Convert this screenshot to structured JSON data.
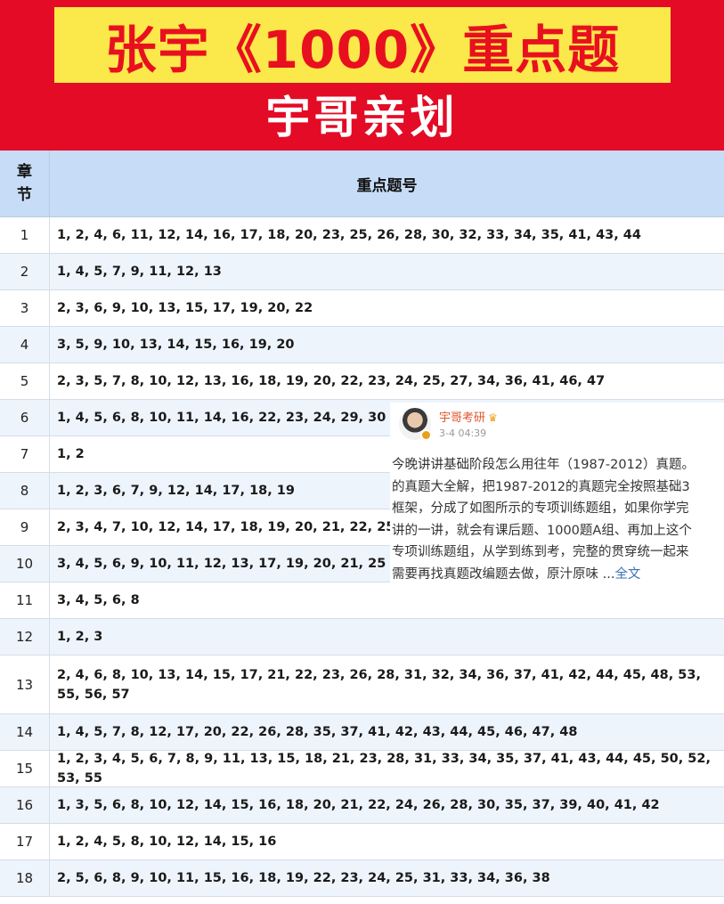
{
  "banner": {
    "title": "张宇《1000》重点题",
    "subtitle": "宇哥亲划"
  },
  "table": {
    "header_chapter_line1": "章",
    "header_chapter_line2": "节",
    "header_nums": "重点题号",
    "rows": [
      {
        "chapter": "1",
        "nums": "1, 2, 4, 6, 11, 12, 14, 16, 17, 18, 20, 23, 25, 26, 28, 30, 32, 33, 34, 35, 41, 43, 44"
      },
      {
        "chapter": "2",
        "nums": "1, 4, 5, 7, 9, 11, 12, 13"
      },
      {
        "chapter": "3",
        "nums": "2, 3, 6, 9, 10, 13, 15, 17, 19, 20, 22"
      },
      {
        "chapter": "4",
        "nums": "3, 5, 9, 10, 13, 14, 15, 16, 19, 20"
      },
      {
        "chapter": "5",
        "nums": "2, 3, 5, 7, 8, 10, 12, 13, 16, 18, 19, 20, 22, 23, 24, 25, 27, 34, 36, 41, 46, 47"
      },
      {
        "chapter": "6",
        "nums": "1, 4, 5, 6, 8, 10, 11, 14, 16, 22, 23, 24, 29, 30"
      },
      {
        "chapter": "7",
        "nums": "1, 2"
      },
      {
        "chapter": "8",
        "nums": "1, 2, 3, 6, 7, 9, 12, 14, 17, 18, 19"
      },
      {
        "chapter": "9",
        "nums": "2, 3, 4, 7, 10, 12, 14, 17, 18, 19, 20, 21, 22, 25, 26"
      },
      {
        "chapter": "10",
        "nums": "3, 4, 5, 6, 9, 10, 11, 12, 13, 17, 19, 20, 21, 25"
      },
      {
        "chapter": "11",
        "nums": "3, 4, 5, 6, 8"
      },
      {
        "chapter": "12",
        "nums": "1, 2, 3"
      },
      {
        "chapter": "13",
        "nums": "2, 4, 6, 8, 10, 13, 14, 15, 17, 21, 22, 23, 26, 28, 31, 32, 34, 36, 37, 41, 42, 44, 45, 48, 53, 55, 56, 57"
      },
      {
        "chapter": "14",
        "nums": "1, 4, 5, 7, 8, 12, 17, 20, 22, 26, 28, 35, 37, 41, 42, 43, 44, 45, 46, 47, 48"
      },
      {
        "chapter": "15",
        "nums": "1, 2, 3, 4, 5, 6, 7, 8, 9, 11, 13, 15, 18, 21, 23, 28, 31, 33, 34, 35, 37, 41, 43, 44, 45, 50, 52, 53, 55"
      },
      {
        "chapter": "16",
        "nums": "1, 3, 5, 6, 8, 10, 12, 14, 15, 16, 18, 20, 21, 22, 24, 26, 28, 30, 35, 37, 39, 40, 41, 42"
      },
      {
        "chapter": "17",
        "nums": "1, 2, 4, 5, 8, 10, 12, 14, 15, 16"
      },
      {
        "chapter": "18",
        "nums": "2, 5, 6, 8, 9, 10, 11, 15, 16, 18, 19, 22, 23, 24, 25, 31, 33, 34, 36, 38"
      }
    ]
  },
  "post": {
    "author": "宇哥考研",
    "time": "3-4 04:39",
    "text": "今晚讲讲基础阶段怎么用往年（1987-2012）真题。\n的真题大全解，把1987-2012的真题完全按照基础3\n框架，分成了如图所示的专项训练题组，如果你学完\n讲的一讲，就会有课后题、1000题A组、再加上这个\n专项训练题组，从学到练到考，完整的贯穿统一起来\n需要再找真题改编题去做，原汁原味 ...",
    "full_link": "全文",
    "avatar_icon": "user-avatar",
    "badge_icon": "verified-badge-icon",
    "crown_icon": "crown-icon"
  }
}
